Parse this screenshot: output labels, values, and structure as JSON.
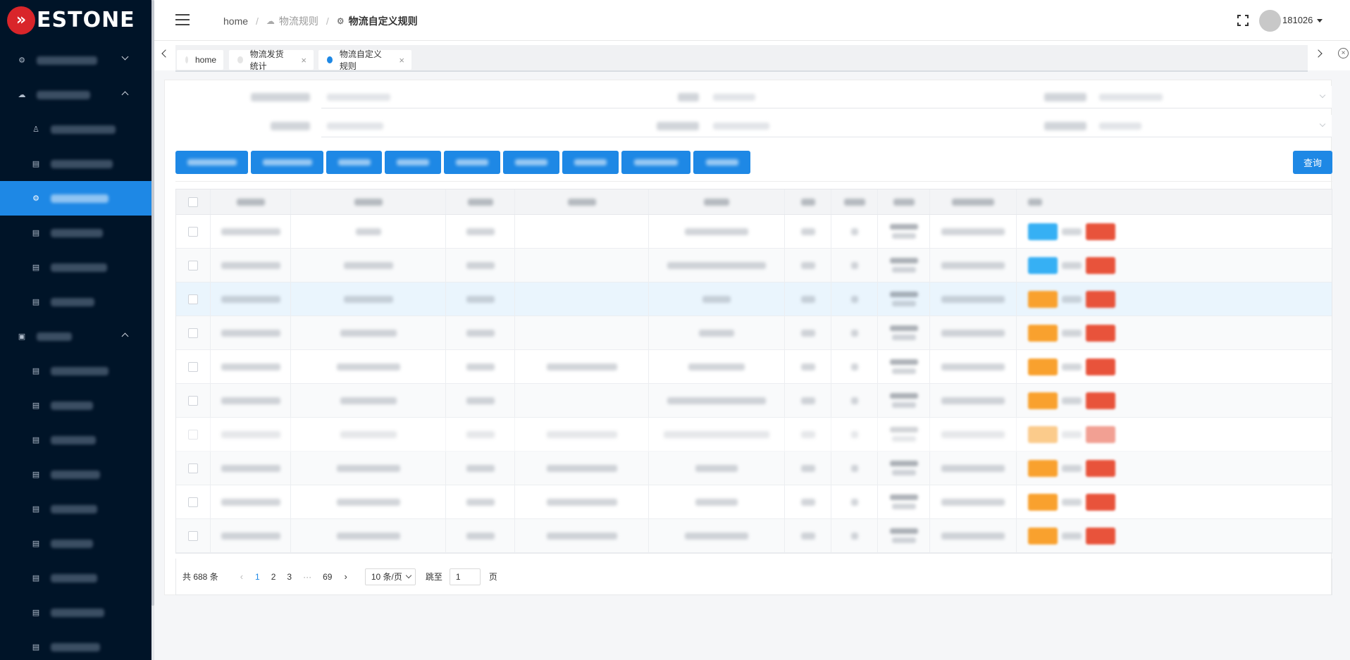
{
  "brand": {
    "name": "ESTONE"
  },
  "header": {
    "breadcrumb": [
      {
        "label": "home"
      },
      {
        "label": "物流规则"
      },
      {
        "label": "物流自定义规则"
      }
    ],
    "username": "181026"
  },
  "tabs": [
    {
      "label": "home",
      "closable": false,
      "active": false
    },
    {
      "label": "物流发货统计",
      "closable": true,
      "active": false
    },
    {
      "label": "物流自定义规则",
      "closable": true,
      "active": true
    }
  ],
  "sidebar": {
    "colors": {
      "background": "#001428",
      "active": "#1e88e5"
    },
    "items": [
      {
        "type": "parent",
        "icon": "gear-icon",
        "expanded": false
      },
      {
        "type": "parent",
        "icon": "car-icon",
        "expanded": true
      },
      {
        "type": "child",
        "icon": "user-icon"
      },
      {
        "type": "child",
        "icon": "list-icon"
      },
      {
        "type": "child",
        "icon": "gear-icon",
        "active": true
      },
      {
        "type": "child",
        "icon": "list-icon"
      },
      {
        "type": "child",
        "icon": "list-icon"
      },
      {
        "type": "child",
        "icon": "list-icon"
      },
      {
        "type": "parent",
        "icon": "chart-icon",
        "expanded": true
      },
      {
        "type": "child",
        "icon": "list-icon"
      },
      {
        "type": "child",
        "icon": "list-icon"
      },
      {
        "type": "child",
        "icon": "list-icon"
      },
      {
        "type": "child",
        "icon": "list-icon"
      },
      {
        "type": "child",
        "icon": "list-icon"
      },
      {
        "type": "child",
        "icon": "list-icon"
      },
      {
        "type": "child",
        "icon": "list-icon"
      },
      {
        "type": "child",
        "icon": "list-icon"
      },
      {
        "type": "child",
        "icon": "list-icon"
      }
    ]
  },
  "toolbar": {
    "query_label": "查询",
    "accent": "#1e88e5"
  },
  "table": {
    "row_count": 10,
    "operation_colors": {
      "view": "#36b0f4",
      "edit": "#f9a12e",
      "delete": "#e8533b"
    },
    "rows": [
      {
        "dept_lines": 1,
        "op": "blue"
      },
      {
        "dept_lines": 2,
        "op": "blue"
      },
      {
        "dept_lines": 2,
        "op": "orange",
        "highlighted": true
      },
      {
        "dept_lines": 2,
        "dept_top": "物流部",
        "op": "orange"
      },
      {
        "dept_lines": 2,
        "dept_top": "物流部",
        "op": "orange"
      },
      {
        "dept_lines": 2,
        "dept_top": "物流部",
        "op": "orange"
      },
      {
        "dept_lines": 2,
        "dept_top": "物流部",
        "op": "orange"
      },
      {
        "dept_lines": 2,
        "dept_top": "物流部",
        "op": "orange"
      },
      {
        "dept_lines": 2,
        "op": "orange"
      },
      {
        "dept_lines": 2,
        "op": "orange"
      }
    ]
  },
  "pagination": {
    "total_label": "共 688 条",
    "pages": [
      "1",
      "2",
      "3"
    ],
    "ellipsis": "···",
    "last_page": "69",
    "current_page": "1",
    "page_size_label": "10 条/页",
    "jump_label": "跳至",
    "jump_value": "1",
    "page_unit": "页"
  }
}
